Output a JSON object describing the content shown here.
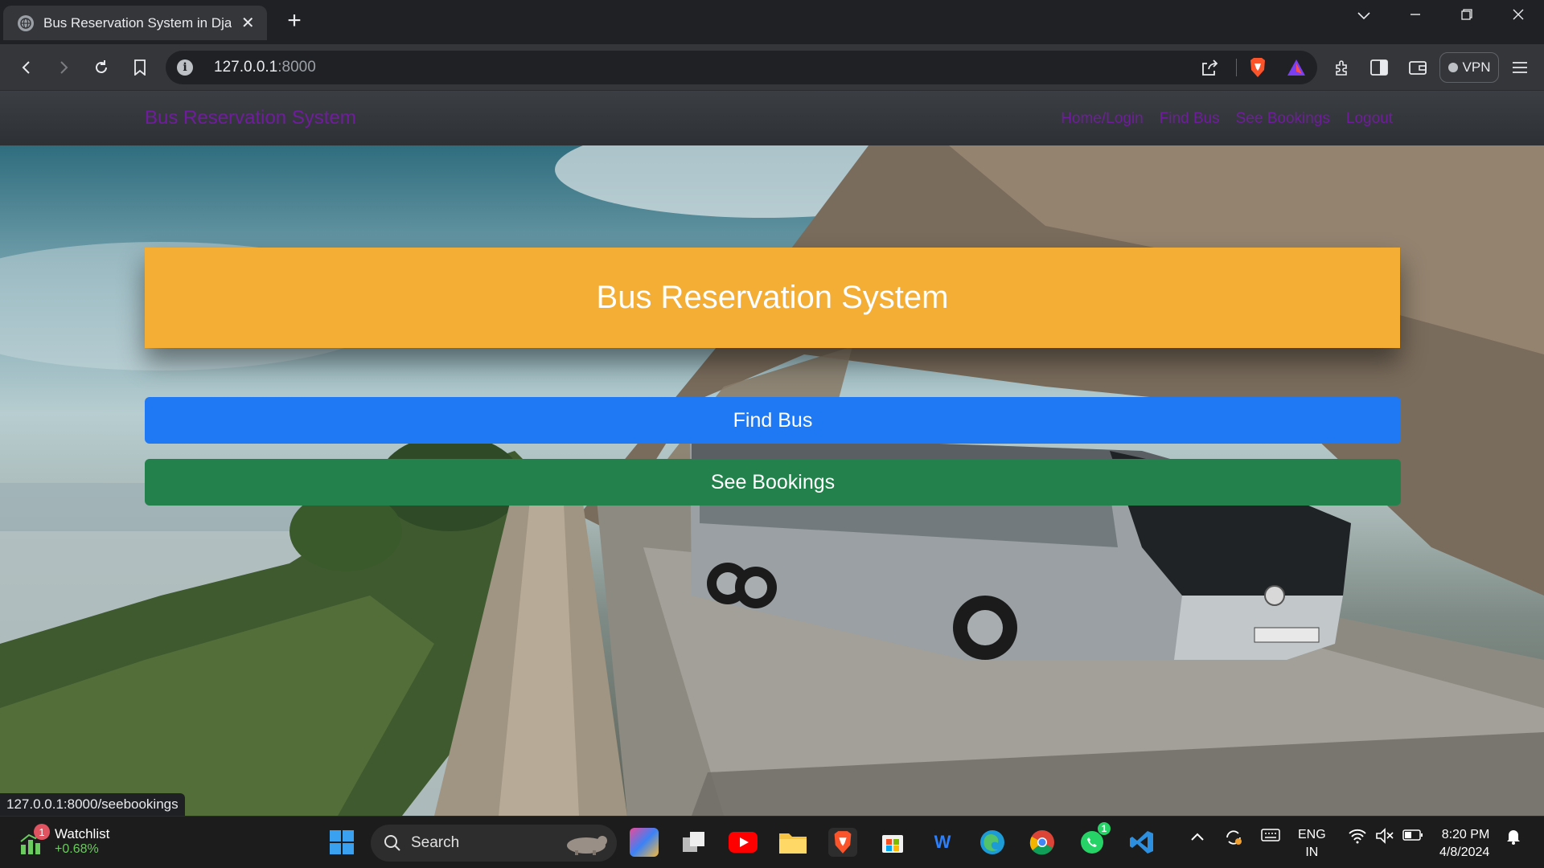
{
  "browser": {
    "tab_title": "Bus Reservation System in Djang",
    "tab_close": "✕",
    "new_tab": "+",
    "url_host": "127.0.0.1",
    "url_port": ":8000",
    "vpn_label": "VPN",
    "status_url": "127.0.0.1:8000/seebookings"
  },
  "site": {
    "brand": "Bus Reservation System",
    "nav": {
      "home": "Home/Login",
      "find": "Find Bus",
      "bookings": "See Bookings",
      "logout": "Logout"
    },
    "banner_title": "Bus Reservation System",
    "find_bus_button": "Find Bus",
    "see_bookings_button": "See Bookings",
    "colors": {
      "brand_text": "#6f1d9c",
      "banner": "#f4ad35",
      "find_button": "#1f78f4",
      "bookings_button": "#23824c"
    }
  },
  "taskbar": {
    "watchlist_label": "Watchlist",
    "watchlist_change": "+0.68%",
    "watchlist_badge": "1",
    "search_label": "Search",
    "whatsapp_badge": "1",
    "language_line1": "ENG",
    "language_line2": "IN",
    "time": "8:20 PM",
    "date": "4/8/2024"
  }
}
